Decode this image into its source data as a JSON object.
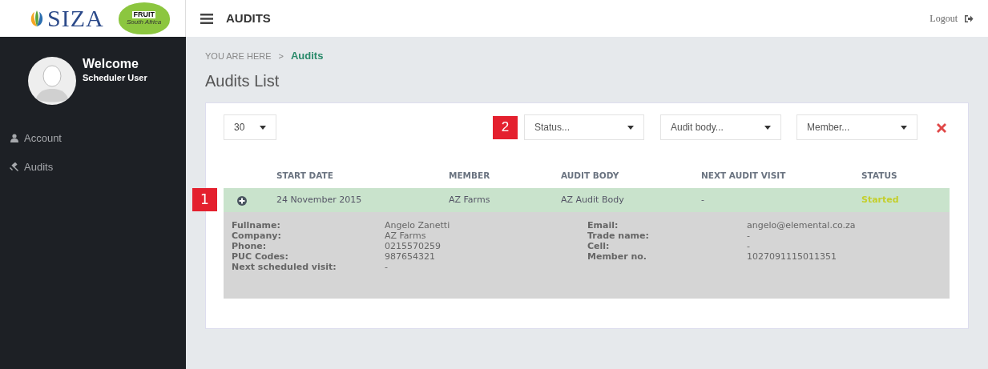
{
  "logo": {
    "brand": "SIZA",
    "fruit": "FRUIT",
    "fruit_sub": "South Africa"
  },
  "header": {
    "title": "AUDITS",
    "logout": "Logout"
  },
  "sidebar": {
    "welcome": "Welcome",
    "user": "Scheduler User",
    "items": [
      {
        "label": "Account",
        "kind": "person"
      },
      {
        "label": "Audits",
        "kind": "gavel"
      }
    ]
  },
  "breadcrumb": {
    "prefix": "YOU ARE HERE",
    "separator": ">",
    "current": "Audits"
  },
  "page_title": "Audits List",
  "page_size": "30",
  "filters": [
    {
      "placeholder": "Status...",
      "marker": "2"
    },
    {
      "placeholder": "Audit body..."
    },
    {
      "placeholder": "Member..."
    }
  ],
  "table": {
    "columns": [
      "START DATE",
      "MEMBER",
      "AUDIT BODY",
      "NEXT AUDIT VISIT",
      "STATUS"
    ],
    "rows": [
      {
        "marker": "1",
        "expanded": true,
        "cells": [
          "24 November 2015",
          "AZ Farms",
          "AZ Audit Body",
          "-",
          "Started"
        ],
        "details": {
          "left": [
            {
              "label": "Fullname:",
              "value": "Angelo Zanetti"
            },
            {
              "label": "Company:",
              "value": "AZ Farms"
            },
            {
              "label": "Phone:",
              "value": "0215570259"
            },
            {
              "label": "PUC Codes:",
              "value": "987654321"
            },
            {
              "label": "Next scheduled visit:",
              "value": "-"
            }
          ],
          "right": [
            {
              "label": "Email:",
              "value": "angelo@elemental.co.za"
            },
            {
              "label": "Trade name:",
              "value": "-"
            },
            {
              "label": "Cell:",
              "value": "-"
            },
            {
              "label": "Member no.",
              "value": "1027091115011351"
            }
          ]
        }
      }
    ]
  }
}
